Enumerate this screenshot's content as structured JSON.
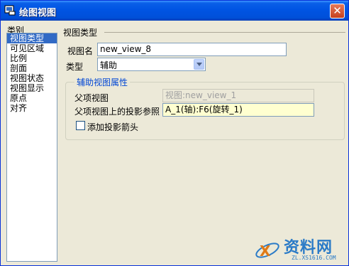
{
  "window": {
    "title": "绘图视图",
    "close_glyph": "✕"
  },
  "categories": {
    "label": "类别",
    "items": [
      "视图类型",
      "可见区域",
      "比例",
      "剖面",
      "视图状态",
      "视图显示",
      "原点",
      "对齐"
    ],
    "selected_index": 0
  },
  "view_type_section": {
    "label": "视图类型",
    "view_name_label": "视图名",
    "view_name_value": "new_view_8",
    "type_label": "类型",
    "type_value": "辅助"
  },
  "aux_props": {
    "group_title": "辅助视图属性",
    "parent_view_label": "父项视图",
    "parent_view_value": "视图:new_view_1",
    "projection_ref_label": "父项视图上的投影参照",
    "projection_ref_value": "A_1(轴):F6(旋转_1)",
    "add_arrow_label": "添加投影箭头",
    "add_arrow_checked": false
  },
  "watermark": {
    "text": "资料网",
    "url": "ZL.XS1616.COM"
  }
}
